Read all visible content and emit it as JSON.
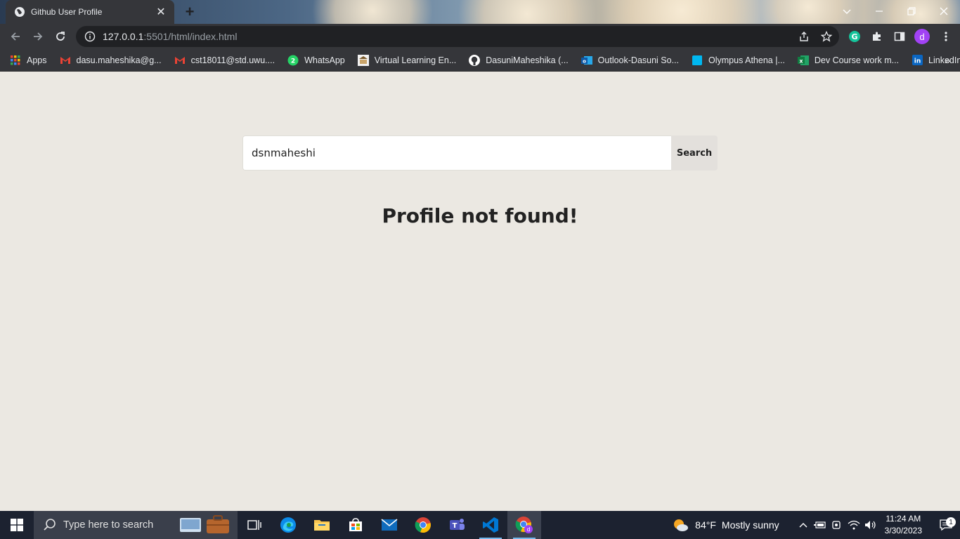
{
  "browser": {
    "tab_title": "Github User Profile",
    "new_tab_label": "+",
    "url_host": "127.0.0.1",
    "url_rest": ":5501/html/index.html",
    "profile_initial": "d",
    "bookmarks": [
      {
        "label": "Apps",
        "icon": "apps-grid-icon"
      },
      {
        "label": "dasu.maheshika@g...",
        "icon": "gmail-icon"
      },
      {
        "label": "cst18011@std.uwu....",
        "icon": "gmail-icon"
      },
      {
        "label": "WhatsApp",
        "icon": "whatsapp-icon"
      },
      {
        "label": "Virtual Learning En...",
        "icon": "vle-icon"
      },
      {
        "label": "DasuniMaheshika (...",
        "icon": "github-icon"
      },
      {
        "label": "Outlook-Dasuni So...",
        "icon": "outlook-icon"
      },
      {
        "label": "Olympus Athena |...",
        "icon": "olympus-icon"
      },
      {
        "label": "Dev Course work m...",
        "icon": "excel-icon"
      },
      {
        "label": "LinkedIn",
        "icon": "linkedin-icon"
      }
    ],
    "bookmarks_more": "»"
  },
  "page": {
    "search_value": "dsnmaheshi",
    "search_button": "Search",
    "message": "Profile not found!"
  },
  "taskbar": {
    "search_placeholder": "Type here to search",
    "weather_temp": "84°F",
    "weather_text": "Mostly sunny",
    "time": "11:24 AM",
    "date": "3/30/2023",
    "notification_count": "1"
  },
  "colors": {
    "page_bg": "#ebe8e2",
    "chrome_dark": "#35363a",
    "taskbar_bg": "#1c2230",
    "profile_purple": "#a142f4"
  }
}
